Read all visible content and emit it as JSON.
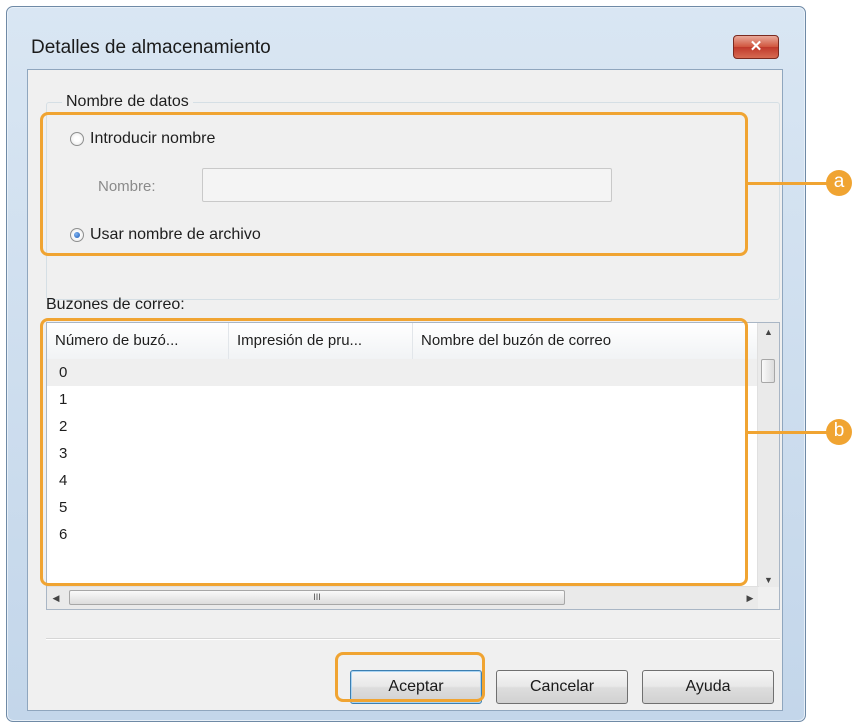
{
  "window": {
    "title": "Detalles de almacenamiento",
    "close_glyph": "✕"
  },
  "data_name_group": {
    "legend": "Nombre de datos",
    "radio_enter_name": "Introducir nombre",
    "name_label": "Nombre:",
    "name_value": "",
    "radio_use_filename": "Usar nombre de archivo",
    "selected_option": "Usar nombre de archivo"
  },
  "mailboxes": {
    "label": "Buzones de correo:",
    "columns": [
      "Número de buzó...",
      "Impresión de pru...",
      "Nombre del buzón de correo"
    ],
    "rows": [
      {
        "number": "0",
        "selected": true
      },
      {
        "number": "1"
      },
      {
        "number": "2"
      },
      {
        "number": "3"
      },
      {
        "number": "4"
      },
      {
        "number": "5"
      },
      {
        "number": "6"
      }
    ],
    "scroll_grip": "III"
  },
  "buttons": {
    "ok": "Aceptar",
    "cancel": "Cancelar",
    "help": "Ayuda"
  },
  "callouts": [
    {
      "letter": "a"
    },
    {
      "letter": "b"
    }
  ],
  "colors": {
    "callout": "#f0a432",
    "close_button": "#c0392b",
    "selection": "#3c7fb1"
  }
}
